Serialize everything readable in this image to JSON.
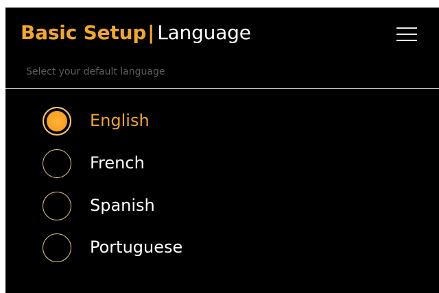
{
  "header": {
    "section": "Basic Setup",
    "separator": "|",
    "page": "Language",
    "menu_icon": "hamburger-menu-icon"
  },
  "subtitle": "Select your default language",
  "options": [
    {
      "label": "English",
      "selected": true
    },
    {
      "label": "French",
      "selected": false
    },
    {
      "label": "Spanish",
      "selected": false
    },
    {
      "label": "Portuguese",
      "selected": false
    }
  ],
  "colors": {
    "accent": "#f4a627",
    "background": "#000000",
    "text": "#ffffff",
    "subtitle": "#5c5c5c"
  }
}
